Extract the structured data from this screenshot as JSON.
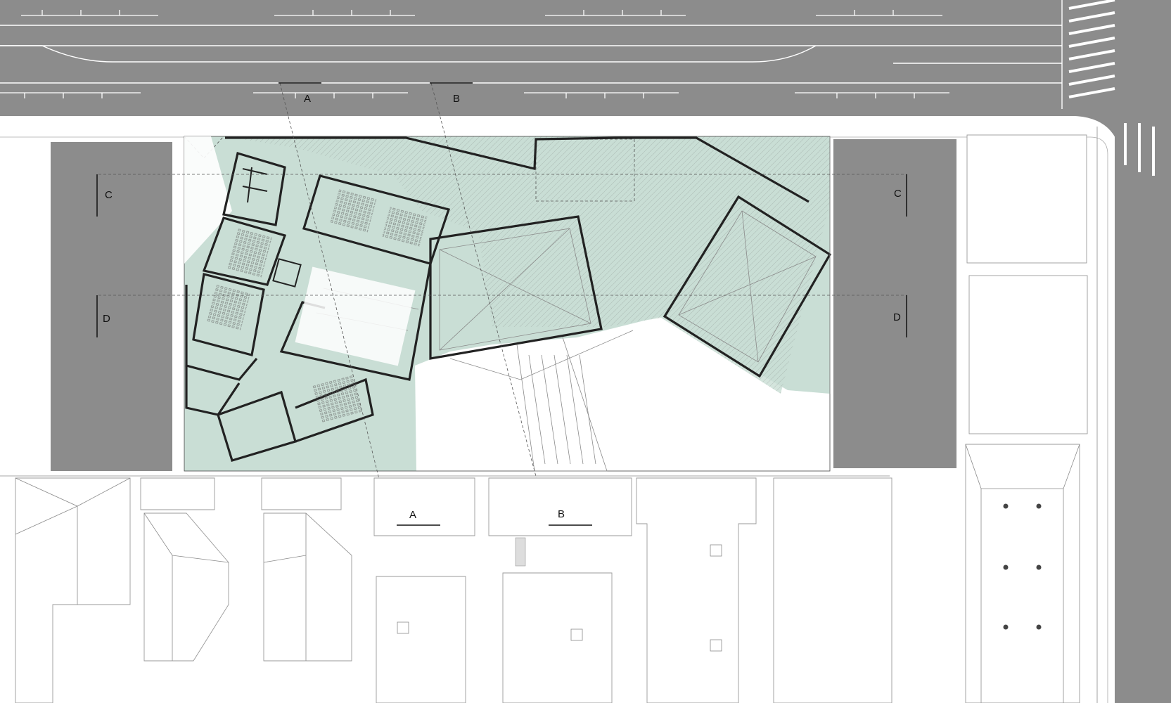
{
  "diagram": {
    "type": "architectural site plan",
    "colors": {
      "road": "#8c8c8c",
      "road_markings": "#ffffff",
      "landscape": "#c9ded5",
      "adjacent_blocks": "#8c8c8c",
      "walls": "#222222",
      "neighbor_outlines": "#9a9a9a",
      "background": "#ffffff"
    },
    "section_markers": [
      {
        "id": "A-north",
        "label": "A"
      },
      {
        "id": "B-north",
        "label": "B"
      },
      {
        "id": "C-west",
        "label": "C"
      },
      {
        "id": "C-east",
        "label": "C"
      },
      {
        "id": "D-west",
        "label": "D"
      },
      {
        "id": "D-east",
        "label": "D"
      },
      {
        "id": "A-south",
        "label": "A"
      },
      {
        "id": "B-south",
        "label": "B"
      }
    ]
  }
}
